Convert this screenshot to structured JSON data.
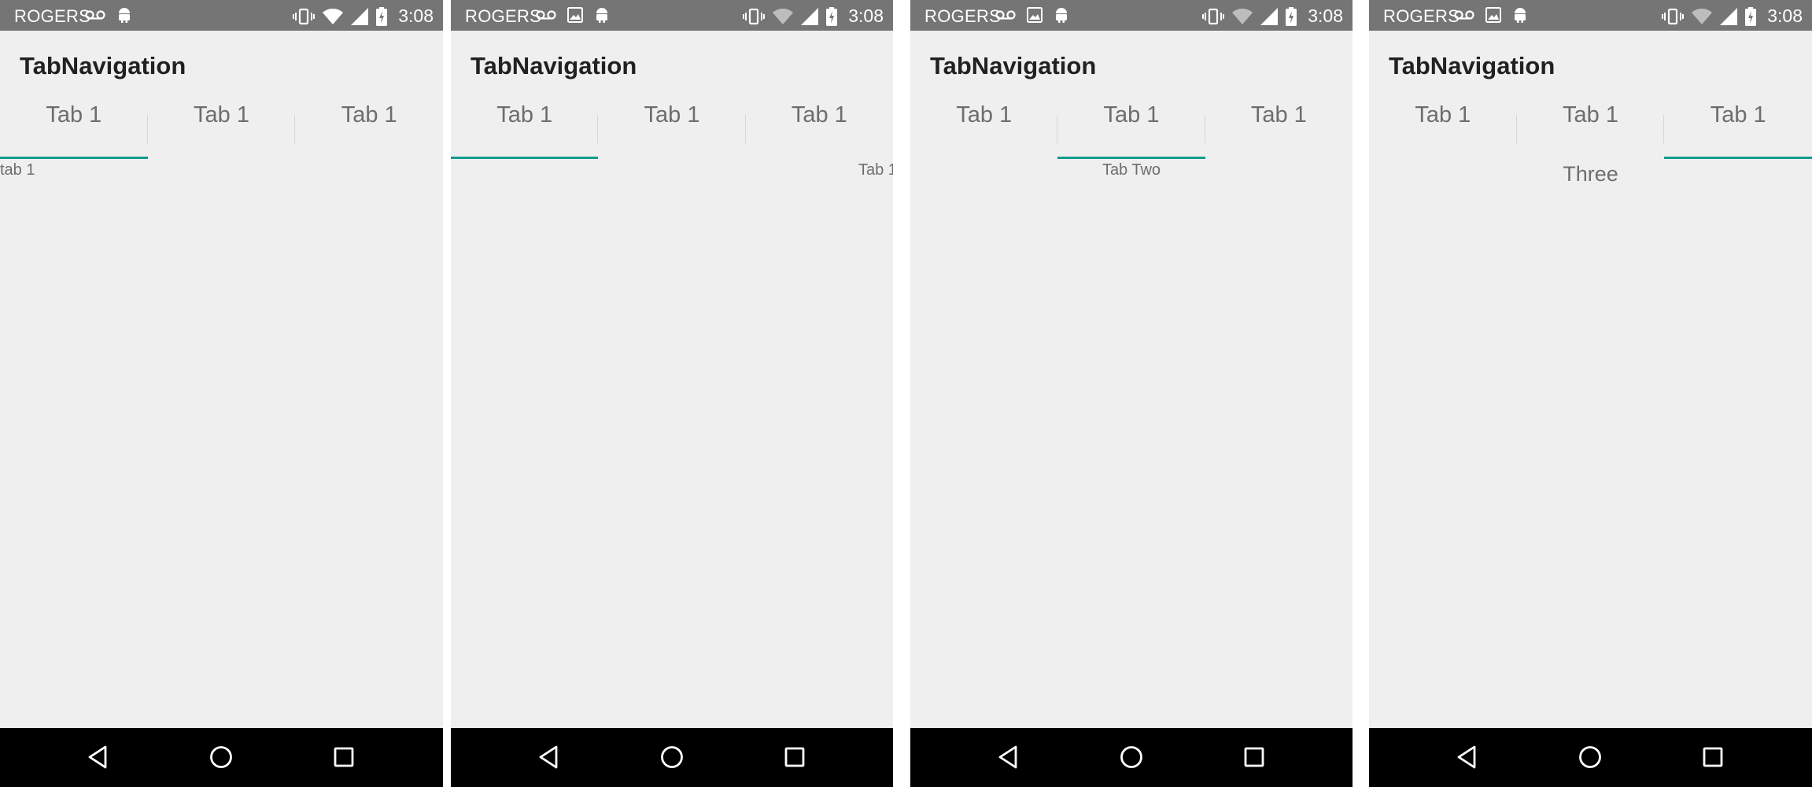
{
  "colors": {
    "accent": "#139a8f",
    "status_bar": "#757575",
    "nav_bar": "#000000",
    "background": "#efefef"
  },
  "screens": [
    {
      "status": {
        "carrier": "ROGERS",
        "time": "3:08",
        "left_icons": [
          "voicemail-icon",
          "android-icon"
        ]
      },
      "app_title": "TabNavigation",
      "tabs": [
        {
          "label": "Tab 1"
        },
        {
          "label": "Tab 1"
        },
        {
          "label": "Tab 1"
        }
      ],
      "selected_tab": 0,
      "content_text": "tab 1"
    },
    {
      "status": {
        "carrier": "ROGERS",
        "time": "3:08",
        "left_icons": [
          "voicemail-icon",
          "image-icon",
          "android-icon"
        ]
      },
      "app_title": "TabNavigation",
      "tabs": [
        {
          "label": "Tab 1"
        },
        {
          "label": "Tab 1"
        },
        {
          "label": "Tab 1"
        }
      ],
      "selected_tab": 0,
      "content_text": "Tab 1"
    },
    {
      "status": {
        "carrier": "ROGERS",
        "time": "3:08",
        "left_icons": [
          "voicemail-icon",
          "image-icon",
          "android-icon"
        ]
      },
      "app_title": "TabNavigation",
      "tabs": [
        {
          "label": "Tab 1"
        },
        {
          "label": "Tab 1"
        },
        {
          "label": "Tab 1"
        }
      ],
      "selected_tab": 1,
      "content_text": "Tab Two"
    },
    {
      "status": {
        "carrier": "ROGERS",
        "time": "3:08",
        "left_icons": [
          "voicemail-icon",
          "image-icon",
          "android-icon"
        ]
      },
      "app_title": "TabNavigation",
      "tabs": [
        {
          "label": "Tab 1"
        },
        {
          "label": "Tab 1"
        },
        {
          "label": "Tab 1"
        }
      ],
      "selected_tab": 2,
      "content_text": "Three"
    }
  ],
  "nav_icons": [
    "back-icon",
    "home-icon",
    "recents-icon"
  ]
}
